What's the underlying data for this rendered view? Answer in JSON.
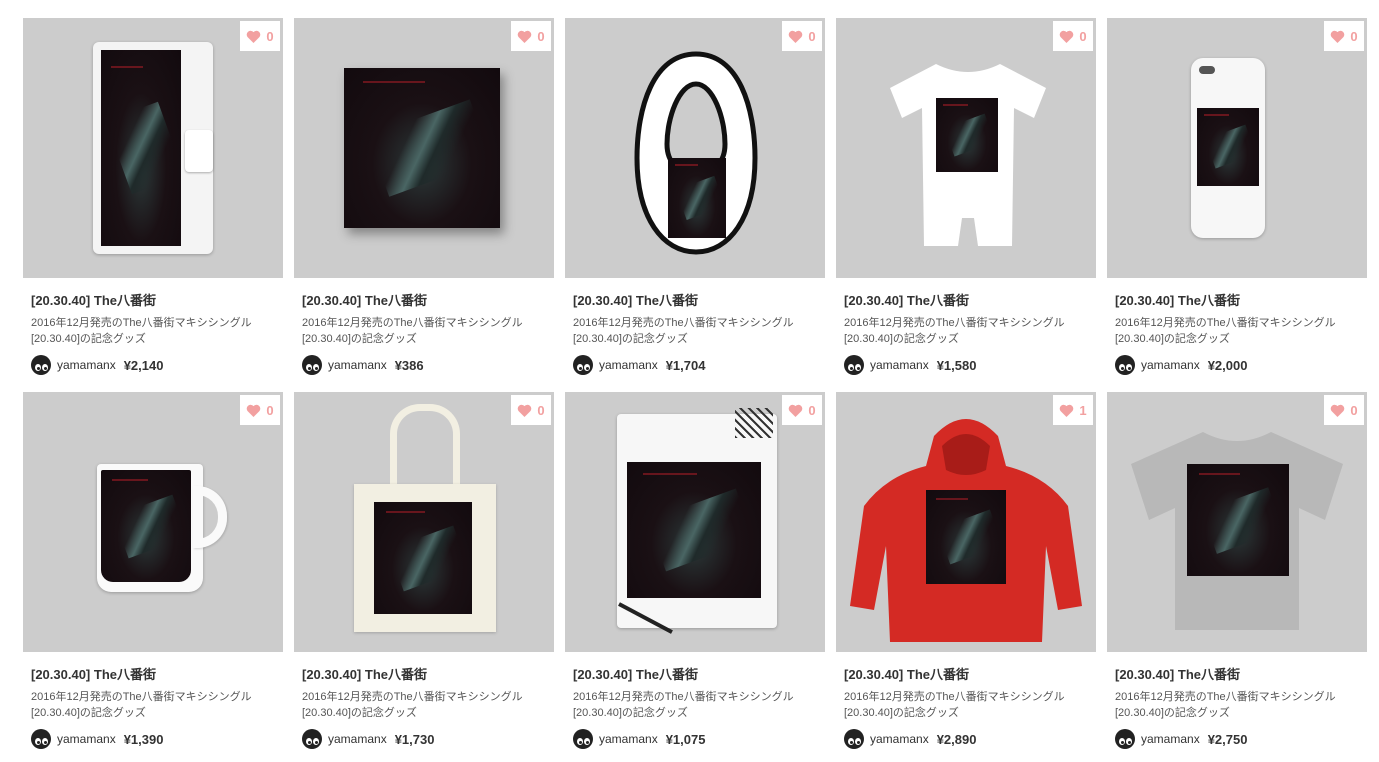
{
  "colors": {
    "tile_bg": "#cccccc",
    "heart": "#f2a0a0",
    "text": "#333333"
  },
  "products": [
    {
      "title": "[20.30.40] The八番街",
      "desc_line1": "2016年12月発売のThe八番街マキシシングル",
      "desc_line2": "[20.30.40]の記念グッズ",
      "user": "yamamanx",
      "price": "¥2,140",
      "likes": "0",
      "kind": "phone-case-notebook"
    },
    {
      "title": "[20.30.40] The八番街",
      "desc_line1": "2016年12月発売のThe八番街マキシシングル",
      "desc_line2": "[20.30.40]の記念グッズ",
      "user": "yamamanx",
      "price": "¥386",
      "likes": "0",
      "kind": "sticker"
    },
    {
      "title": "[20.30.40] The八番街",
      "desc_line1": "2016年12月発売のThe八番街マキシシングル",
      "desc_line2": "[20.30.40]の記念グッズ",
      "user": "yamamanx",
      "price": "¥1,704",
      "likes": "0",
      "kind": "bib"
    },
    {
      "title": "[20.30.40] The八番街",
      "desc_line1": "2016年12月発売のThe八番街マキシシングル",
      "desc_line2": "[20.30.40]の記念グッズ",
      "user": "yamamanx",
      "price": "¥1,580",
      "likes": "0",
      "kind": "rompers"
    },
    {
      "title": "[20.30.40] The八番街",
      "desc_line1": "2016年12月発売のThe八番街マキシシングル",
      "desc_line2": "[20.30.40]の記念グッズ",
      "user": "yamamanx",
      "price": "¥2,000",
      "likes": "0",
      "kind": "phone-case"
    },
    {
      "title": "[20.30.40] The八番街",
      "desc_line1": "2016年12月発売のThe八番街マキシシングル",
      "desc_line2": "[20.30.40]の記念グッズ",
      "user": "yamamanx",
      "price": "¥1,390",
      "likes": "0",
      "kind": "mug"
    },
    {
      "title": "[20.30.40] The八番街",
      "desc_line1": "2016年12月発売のThe八番街マキシシングル",
      "desc_line2": "[20.30.40]の記念グッズ",
      "user": "yamamanx",
      "price": "¥1,730",
      "likes": "0",
      "kind": "tote-bag"
    },
    {
      "title": "[20.30.40] The八番街",
      "desc_line1": "2016年12月発売のThe八番街マキシシングル",
      "desc_line2": "[20.30.40]の記念グッズ",
      "user": "yamamanx",
      "price": "¥1,075",
      "likes": "0",
      "kind": "notebook"
    },
    {
      "title": "[20.30.40] The八番街",
      "desc_line1": "2016年12月発売のThe八番街マキシシングル",
      "desc_line2": "[20.30.40]の記念グッズ",
      "user": "yamamanx",
      "price": "¥2,890",
      "likes": "1",
      "kind": "hoodie"
    },
    {
      "title": "[20.30.40] The八番街",
      "desc_line1": "2016年12月発売のThe八番街マキシシングル",
      "desc_line2": "[20.30.40]の記念グッズ",
      "user": "yamamanx",
      "price": "¥2,750",
      "likes": "0",
      "kind": "t-shirt"
    }
  ]
}
